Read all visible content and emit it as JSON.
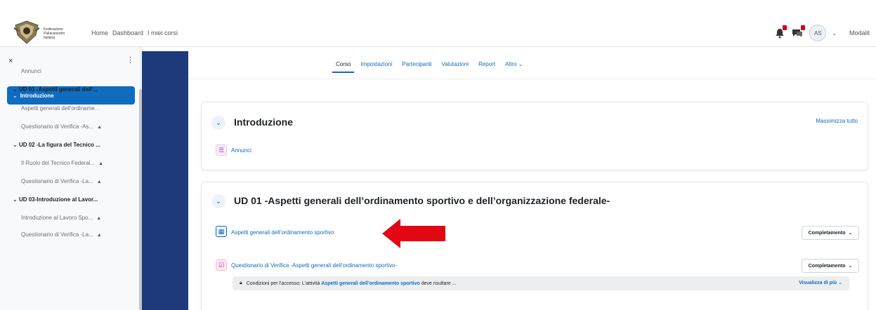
{
  "navbar": {
    "logo_text": "Federazione Pallacanestro Italiana",
    "primary_nav": [
      "Home",
      "Dashboard",
      "I miei corsi"
    ],
    "avatar_initials": "AS",
    "mode_label": "Modalit",
    "icons": [
      "notification-bell-icon",
      "chat-icon",
      "chevron-down-icon"
    ],
    "badge_color": "#d0021b"
  },
  "drawer": {
    "close_symbol": "×",
    "kebab_symbol": "⋮",
    "active_section": "Introduzione",
    "entries": [
      {
        "type": "item",
        "label": "Annunci",
        "locked": false
      },
      {
        "type": "section",
        "label": "UD 01 -Aspetti generali dell'..."
      },
      {
        "type": "item",
        "label": "Aspetti generali dell'ordiname...",
        "locked": false
      },
      {
        "type": "item",
        "label": "Questionario di Verifica -As...",
        "locked": true
      },
      {
        "type": "section",
        "label": "UD 02 -La figura del Tecnico ..."
      },
      {
        "type": "item",
        "label": "Il Ruolo del Tecnico Federal...",
        "locked": true
      },
      {
        "type": "item",
        "label": "Questionario di Verifica -La...",
        "locked": true
      },
      {
        "type": "section",
        "label": "UD 03-Introduzione al Lavor..."
      },
      {
        "type": "item",
        "label": "Introduzione al Lavoro Spo...",
        "locked": true
      },
      {
        "type": "item",
        "label": "Questionario di Verifica -La...",
        "locked": true
      }
    ]
  },
  "course_nav": {
    "tabs": [
      "Corso",
      "Impostazioni",
      "Partecipanti",
      "Valutazioni",
      "Report",
      "Altro"
    ],
    "active": "Corso",
    "more_caret": "⌄"
  },
  "sections": {
    "intro": {
      "title": "Introduzione",
      "collapse_all": "Massimizza tutto",
      "activity": "Annunci"
    },
    "ud01": {
      "title": "UD 01 -Aspetti generali dell’ordinamento sportivo e dell’organizzazione federale-",
      "activities": [
        {
          "label": "Aspetti generali dell’ordinamento sportivo",
          "completion": "Completamento"
        },
        {
          "label": "Questionario di Verifica -Aspetti generali dell’ordinamento sportivo-",
          "completion": "Completamento"
        }
      ],
      "restriction_prefix": "Condizioni per l'accesso: L'attività",
      "restriction_link": "Aspetti generali dell’ordinamento sportivo",
      "restriction_suffix": "deve risultare ...",
      "show_more": "Visualizza di più"
    }
  },
  "colors": {
    "accent": "#0f6cbf",
    "sidebar_strip": "#1e3a7b",
    "arrow": "#e30613"
  }
}
